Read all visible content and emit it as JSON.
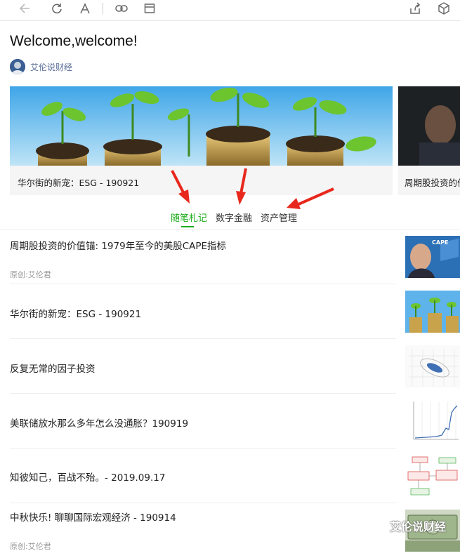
{
  "article": {
    "title": "Welcome,welcome!",
    "author": "艾伦说财经"
  },
  "banners": [
    {
      "caption": "华尔街的新宠：ESG - 190921"
    },
    {
      "caption": "周期股投资的价"
    }
  ],
  "tabs": [
    {
      "label": "随笔札记",
      "active": true
    },
    {
      "label": "数字金融",
      "active": false
    },
    {
      "label": "资产管理",
      "active": false
    }
  ],
  "items": [
    {
      "title": "周期股投资的价值锚: 1979年至今的美股CAPE指标",
      "meta": "原创:艾伦君",
      "thumb_text": "CAPE"
    },
    {
      "title": "华尔街的新宠：ESG - 190921",
      "meta": ""
    },
    {
      "title": "反复无常的因子投资",
      "meta": ""
    },
    {
      "title": "美联储放水那么多年怎么没通胀？190919",
      "meta": ""
    },
    {
      "title": "知彼知己，百战不殆。- 2019.09.17",
      "meta": ""
    },
    {
      "title": "中秋快乐! 聊聊国际宏观经济 - 190914",
      "meta": "原创:艾伦君"
    }
  ],
  "watermark": "艾伦说财经",
  "colors": {
    "accent": "#1aad19",
    "link": "#576b95",
    "arrow": "#e8281c"
  }
}
